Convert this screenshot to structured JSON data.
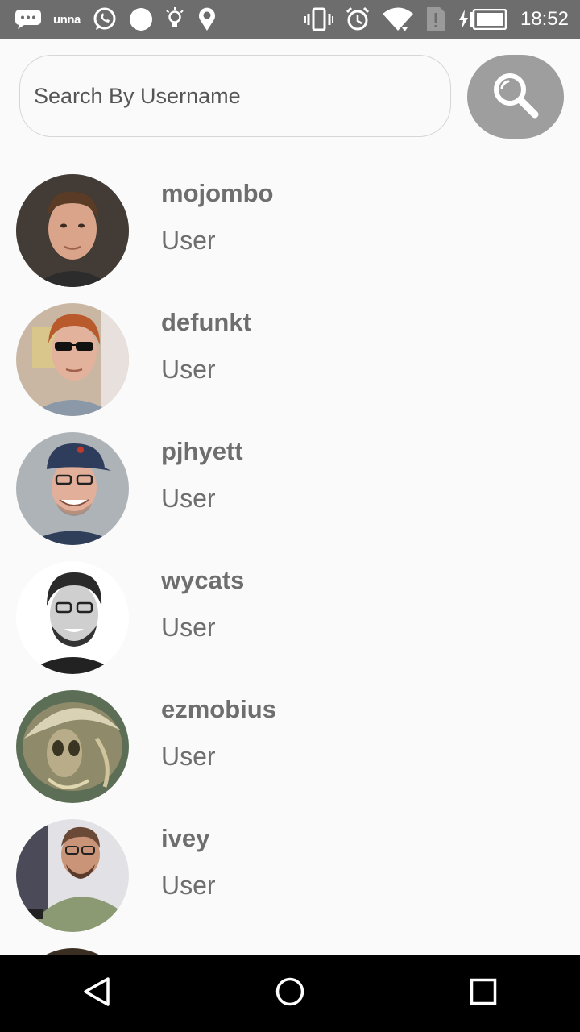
{
  "status_bar": {
    "carrier": "unna",
    "time": "18:52",
    "icons": [
      "message-icon",
      "carrier-logo",
      "whatsapp-icon",
      "circle-icon",
      "lightbulb-icon",
      "location-icon",
      "vibrate-icon",
      "alarm-icon",
      "wifi-icon",
      "sim-alert-icon",
      "battery-charging-icon"
    ]
  },
  "search": {
    "placeholder": "Search By Username",
    "value": "",
    "button_icon": "search-icon"
  },
  "users": [
    {
      "username": "mojombo",
      "type": "User"
    },
    {
      "username": "defunkt",
      "type": "User"
    },
    {
      "username": "pjhyett",
      "type": "User"
    },
    {
      "username": "wycats",
      "type": "User"
    },
    {
      "username": "ezmobius",
      "type": "User"
    },
    {
      "username": "ivey",
      "type": "User"
    }
  ],
  "nav": {
    "icons": [
      "back-icon",
      "home-icon",
      "recents-icon"
    ]
  },
  "colors": {
    "status_bar": "#6d6d6d",
    "background": "#fafafa",
    "search_button": "#9e9e9e",
    "text": "#6e6e6e",
    "nav_bar": "#000000"
  }
}
